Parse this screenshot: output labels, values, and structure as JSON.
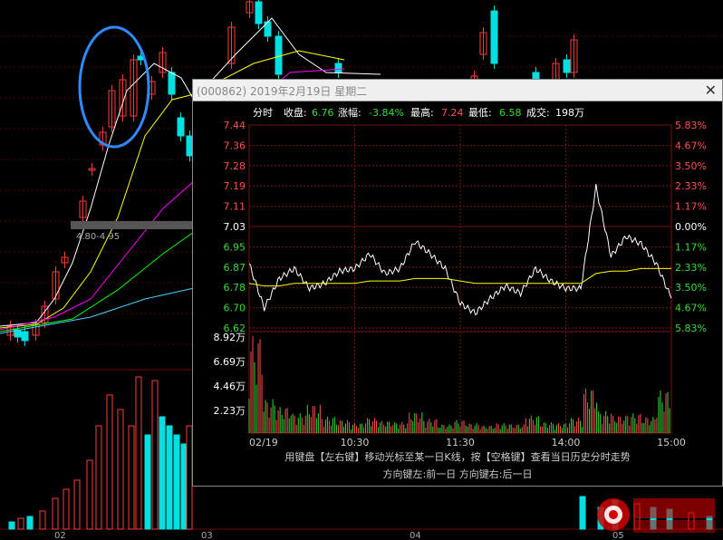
{
  "background_chart": {
    "x_ticks": [
      "02",
      "03",
      "04",
      "05"
    ],
    "price_tag": "4.80-4.95",
    "colors": {
      "up": "#ff3b3b",
      "down": "#00e0e0",
      "ma5": "#ffffff",
      "ma10": "#ffff00",
      "ma20": "#ff00ff",
      "ma30": "#00ff00",
      "ma60": "#4ad0ff",
      "highlight": "#2e8bff"
    }
  },
  "dialog": {
    "title": "(000862) 2019年2月19日 星期二",
    "close_label": "✕",
    "info": {
      "label_fenshi": "分时",
      "label_close": "收盘:",
      "close": "6.76",
      "label_change": "涨幅:",
      "change": "-3.84%",
      "label_high": "最高:",
      "high": "7.24",
      "label_low": "最低:",
      "low": "6.58",
      "label_volume": "成交:",
      "volume": "198万"
    },
    "help_line1": "用键盘【左右键】移动光标至某一日K线，按【空格键】查看当日历史分时走势",
    "help_line2": "方向键左:前一日   方向键右:后一日",
    "colors": {
      "up": "#ff5050",
      "down": "#33dd33",
      "flat": "#ffffff",
      "price": "#ffffff",
      "avg": "#ffff00",
      "grid": "#7a1010"
    }
  },
  "chart_data": {
    "type": "line",
    "x_ticks": [
      "02/19",
      "10:30",
      "11:30",
      "14:00",
      "15:00"
    ],
    "y_ticks": [
      "7.44",
      "7.36",
      "7.28",
      "7.19",
      "7.11",
      "7.03",
      "6.95",
      "6.87",
      "6.78",
      "6.70",
      "6.62"
    ],
    "y_ticks_pct": [
      "5.83%",
      "4.67%",
      "3.50%",
      "2.33%",
      "1.17%",
      "0.00%",
      "1.17%",
      "2.33%",
      "3.50%",
      "4.67%",
      "5.83%"
    ],
    "ylim": [
      6.62,
      7.44
    ],
    "prev_close": 7.03,
    "x_index": [
      0,
      10,
      20,
      30,
      40,
      50,
      60,
      70,
      80,
      90,
      100,
      110,
      120,
      130,
      140,
      150,
      160,
      170,
      180,
      190,
      200,
      210,
      220,
      230,
      240
    ],
    "series": [
      {
        "name": "price",
        "values": [
          6.88,
          6.7,
          6.82,
          6.86,
          6.78,
          6.8,
          6.85,
          6.86,
          6.92,
          6.84,
          6.86,
          6.97,
          6.92,
          6.86,
          6.72,
          6.68,
          6.74,
          6.79,
          6.76,
          6.86,
          6.81,
          6.78,
          6.78,
          7.19,
          6.91,
          6.99,
          6.96,
          6.88,
          6.74
        ]
      },
      {
        "name": "avg",
        "values": [
          6.8,
          6.79,
          6.79,
          6.8,
          6.8,
          6.8,
          6.8,
          6.8,
          6.81,
          6.81,
          6.81,
          6.82,
          6.82,
          6.82,
          6.81,
          6.8,
          6.8,
          6.8,
          6.8,
          6.8,
          6.8,
          6.8,
          6.8,
          6.84,
          6.85,
          6.85,
          6.86,
          6.86,
          6.86
        ]
      }
    ],
    "volume_ticks": [
      "8.92万",
      "6.69万",
      "4.46万",
      "2.23万"
    ],
    "volume_max": 8.92,
    "volume": [
      8.9,
      3.1,
      2.4,
      1.8,
      2.6,
      1.5,
      1.2,
      0.9,
      1.4,
      1.1,
      1.0,
      1.9,
      1.3,
      0.8,
      1.2,
      0.9,
      0.7,
      0.9,
      0.8,
      1.6,
      1.0,
      0.9,
      1.4,
      4.1,
      2.0,
      1.6,
      1.8,
      1.5,
      3.9
    ]
  }
}
